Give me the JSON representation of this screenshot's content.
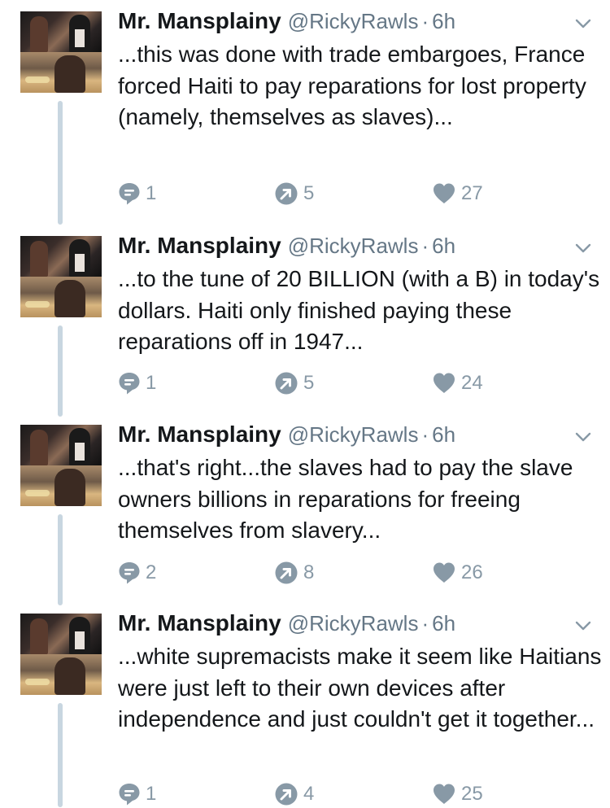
{
  "colors": {
    "text": "#14171a",
    "meta": "#657786",
    "action": "#8899a6",
    "thread_line": "#c8d6e0"
  },
  "tweets": [
    {
      "name": "Mr. Mansplainy",
      "handle": "@RickyRawls",
      "dot": "·",
      "time": "6h",
      "text": "...this was done with trade embargoes, France forced Haiti to pay reparations for lost property (namely, themselves as slaves)...",
      "replies": "1",
      "retweets": "5",
      "likes": "27"
    },
    {
      "name": "Mr. Mansplainy",
      "handle": "@RickyRawls",
      "dot": "·",
      "time": "6h",
      "text": "...to the tune of 20 BILLION (with a B) in today's dollars. Haiti only finished paying these reparations off in 1947...",
      "replies": "1",
      "retweets": "5",
      "likes": "24"
    },
    {
      "name": "Mr. Mansplainy",
      "handle": "@RickyRawls",
      "dot": "·",
      "time": "6h",
      "text": "...that's right...the slaves had to pay the slave owners billions in reparations for freeing themselves from slavery...",
      "replies": "2",
      "retweets": "8",
      "likes": "26"
    },
    {
      "name": "Mr. Mansplainy",
      "handle": "@RickyRawls",
      "dot": "·",
      "time": "6h",
      "text": "...white supremacists make it seem like Haitians were just left to their own devices after independence and just couldn't get it together...",
      "replies": "1",
      "retweets": "4",
      "likes": "25"
    }
  ]
}
